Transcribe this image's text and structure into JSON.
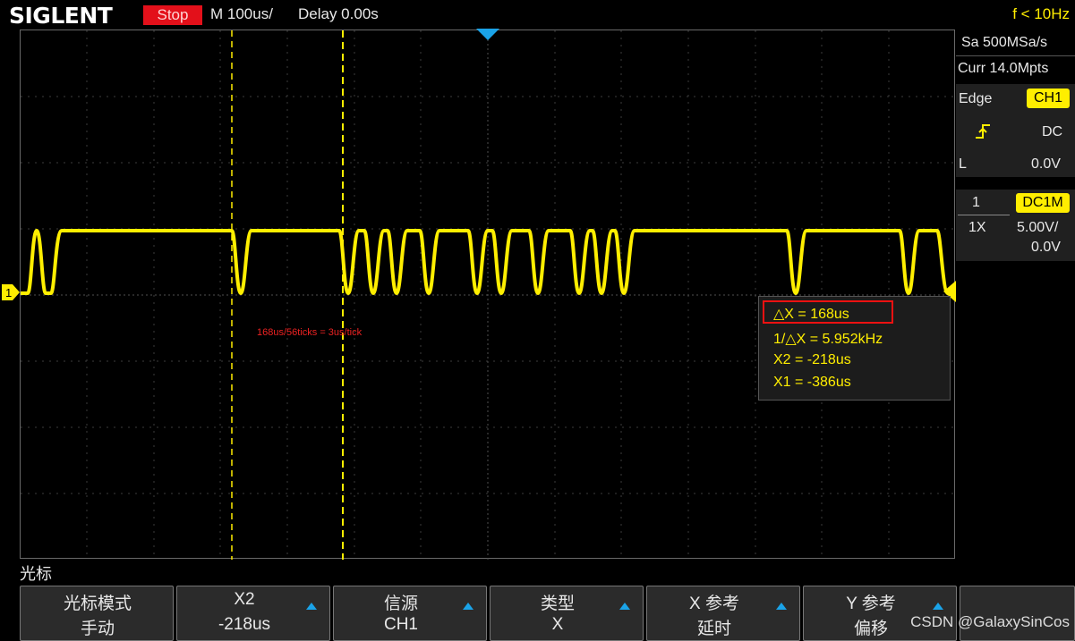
{
  "header": {
    "brand": "SIGLENT",
    "run_state": "Stop",
    "timebase": "M 100us/",
    "delay": "Delay 0.00s",
    "trigger_freq": "f < 10Hz"
  },
  "acquisition": {
    "sample_rate": "Sa 500MSa/s",
    "memory_depth": "Curr 14.0Mpts"
  },
  "trigger": {
    "type": "Edge",
    "source": "CH1",
    "coupling": "DC",
    "level_label": "L",
    "level": "0.0V"
  },
  "channel1": {
    "number": "1",
    "coupling_impedance": "DC1M",
    "probe": "1X",
    "scale": "5.00V/",
    "offset": "0.0V",
    "marker_label": "1"
  },
  "cursor_measure": {
    "delta_x": "△X = 168us",
    "inv_delta_x": "1/△X = 5.952kHz",
    "x2": "X2 = -218us",
    "x1": "X1 = -386us"
  },
  "annotation": "168us/56ticks = 3us/tick",
  "menu": {
    "title": "光标",
    "softkeys": [
      {
        "line1": "光标模式",
        "line2": "手动",
        "has_arrow": false
      },
      {
        "line1": "X2",
        "line2": "-218us",
        "has_arrow": true
      },
      {
        "line1": "信源",
        "line2": "CH1",
        "has_arrow": true
      },
      {
        "line1": "类型",
        "line2": "X",
        "has_arrow": true
      },
      {
        "line1": "X 参考",
        "line2": "延时",
        "has_arrow": true
      },
      {
        "line1": "Y 参考",
        "line2": "偏移",
        "has_arrow": true
      }
    ]
  },
  "watermark": "CSDN @GalaxySinCos",
  "colors": {
    "trace": "#ffee00",
    "stop": "#e3101a",
    "accent": "#1aa3e8"
  }
}
